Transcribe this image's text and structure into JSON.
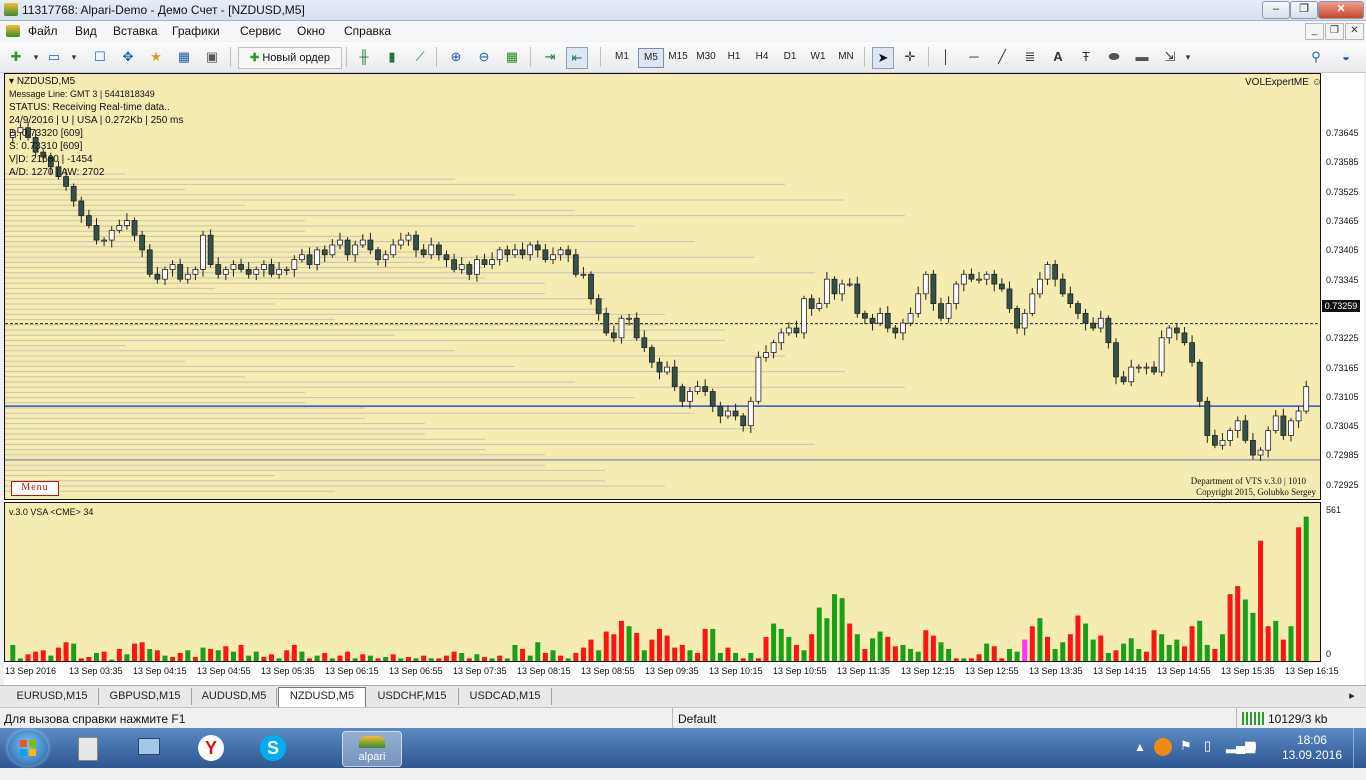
{
  "window": {
    "title": "11317768: Alpari-Demo - Демо Счет - [NZDUSD,M5]",
    "controls": {
      "minimize": "–",
      "restore": "❐",
      "close": "✕"
    }
  },
  "menu": [
    "Файл",
    "Вид",
    "Вставка",
    "Графики",
    "Сервис",
    "Окно",
    "Справка"
  ],
  "toolbar": {
    "new_order": "Новый ордер",
    "timeframes": [
      "M1",
      "M5",
      "M15",
      "M30",
      "H1",
      "H4",
      "D1",
      "W1",
      "MN"
    ],
    "active_timeframe": "M5"
  },
  "chart": {
    "symbol_label": "NZDUSD,M5",
    "overlay_lines": [
      "Message Line: GMT 3 | 5441818349",
      "STATUS:  Receiving Real-time data..",
      "24/9/2016 | U | USA | 0.272Kb | 250 ms",
      "D: 0.73320  [609]",
      "S: 0.73310  [609]",
      "V|D: 21680 | -1454",
      "A/D: 1270 | AW: 2702"
    ],
    "expert_label": "VOLExpertME",
    "menu_badge": "Menu",
    "credit_line_1": "Department of VTS  v.3.0 | 1010",
    "credit_line_2": "Copyright 2015, Golubko Sergey",
    "current_price": "0.73259",
    "blue_level": 0.7309,
    "grey_level": 0.7298,
    "accent_colors": {
      "bull": "#ffffff",
      "bear": "#35524a",
      "vol_up": "#18a018",
      "vol_down": "#ff1414",
      "vol_climax": "#ff30ff",
      "level": "#3050d0"
    }
  },
  "chart_data": [
    {
      "type": "candlestick",
      "title": "NZDUSD,M5",
      "ylim": [
        0.729,
        0.7377
      ],
      "y_ticks": [
        "0.73645",
        "0.73585",
        "0.73525",
        "0.73465",
        "0.73405",
        "0.73345",
        "0.73285",
        "0.73225",
        "0.73165",
        "0.73105",
        "0.73045",
        "0.72985",
        "0.72925"
      ],
      "x_ticks": [
        "13 Sep 2016",
        "13 Sep 03:35",
        "13 Sep 04:15",
        "13 Sep 04:55",
        "13 Sep 05:35",
        "13 Sep 06:15",
        "13 Sep 06:55",
        "13 Sep 07:35",
        "13 Sep 08:15",
        "13 Sep 08:55",
        "13 Sep 09:35",
        "13 Sep 10:15",
        "13 Sep 10:55",
        "13 Sep 11:35",
        "13 Sep 12:15",
        "13 Sep 12:55",
        "13 Sep 13:35",
        "13 Sep 14:15",
        "13 Sep 14:55",
        "13 Sep 15:35",
        "13 Sep 16:15"
      ],
      "close": [
        0.7365,
        0.7366,
        0.7364,
        0.7361,
        0.736,
        0.7358,
        0.7356,
        0.7354,
        0.7351,
        0.7348,
        0.7346,
        0.7343,
        0.7343,
        0.7345,
        0.7346,
        0.7347,
        0.7344,
        0.7341,
        0.7336,
        0.7335,
        0.7337,
        0.7338,
        0.7335,
        0.7336,
        0.7337,
        0.7344,
        0.7338,
        0.7336,
        0.7337,
        0.7338,
        0.7337,
        0.7336,
        0.7337,
        0.7338,
        0.7336,
        0.7337,
        0.7337,
        0.7339,
        0.734,
        0.7338,
        0.7341,
        0.734,
        0.7342,
        0.7343,
        0.734,
        0.7342,
        0.7343,
        0.7341,
        0.7339,
        0.734,
        0.7342,
        0.7343,
        0.7344,
        0.7341,
        0.734,
        0.7342,
        0.734,
        0.7339,
        0.7337,
        0.7338,
        0.7336,
        0.7339,
        0.7338,
        0.7339,
        0.7341,
        0.734,
        0.7341,
        0.734,
        0.7342,
        0.7341,
        0.7339,
        0.734,
        0.7341,
        0.734,
        0.7336,
        0.7336,
        0.7331,
        0.7328,
        0.7324,
        0.7323,
        0.7327,
        0.7327,
        0.7323,
        0.7321,
        0.7318,
        0.7316,
        0.7317,
        0.7313,
        0.731,
        0.7312,
        0.7313,
        0.7312,
        0.7309,
        0.7307,
        0.7308,
        0.7307,
        0.7305,
        0.731,
        0.7319,
        0.732,
        0.7322,
        0.7324,
        0.7325,
        0.7324,
        0.7331,
        0.7329,
        0.733,
        0.7335,
        0.7332,
        0.7334,
        0.7334,
        0.7328,
        0.7327,
        0.7326,
        0.7328,
        0.7325,
        0.7324,
        0.7326,
        0.7328,
        0.7332,
        0.7336,
        0.733,
        0.7327,
        0.733,
        0.7334,
        0.7336,
        0.7335,
        0.7335,
        0.7336,
        0.7334,
        0.7333,
        0.7329,
        0.7325,
        0.7328,
        0.7332,
        0.7335,
        0.7338,
        0.7335,
        0.7332,
        0.733,
        0.7328,
        0.7326,
        0.7325,
        0.7327,
        0.7322,
        0.7315,
        0.7314,
        0.7317,
        0.7317,
        0.7317,
        0.7316,
        0.7323,
        0.7325,
        0.7324,
        0.7322,
        0.7318,
        0.731,
        0.7303,
        0.7301,
        0.7302,
        0.7304,
        0.7306,
        0.7302,
        0.7299,
        0.73,
        0.7304,
        0.7307,
        0.7303,
        0.7306,
        0.7308,
        0.7313
      ],
      "volume_ylim": [
        0,
        561
      ],
      "volume_max_label": "561",
      "volume_min_label": "0",
      "volumes": [
        60,
        10,
        25,
        35,
        40,
        20,
        50,
        70,
        65,
        10,
        15,
        30,
        35,
        5,
        45,
        25,
        65,
        70,
        45,
        40,
        20,
        15,
        30,
        40,
        15,
        50,
        45,
        40,
        55,
        35,
        60,
        20,
        35,
        15,
        25,
        10,
        40,
        60,
        35,
        10,
        20,
        30,
        10,
        20,
        35,
        10,
        25,
        20,
        10,
        15,
        25,
        10,
        15,
        10,
        20,
        10,
        10,
        20,
        35,
        30,
        10,
        25,
        15,
        10,
        20,
        10,
        60,
        45,
        20,
        70,
        30,
        40,
        20,
        10,
        30,
        50,
        80,
        40,
        110,
        100,
        150,
        130,
        105,
        40,
        80,
        120,
        95,
        50,
        60,
        40,
        30,
        120,
        120,
        30,
        50,
        30,
        10,
        30,
        10,
        90,
        140,
        120,
        90,
        60,
        40,
        100,
        200,
        160,
        250,
        235,
        140,
        100,
        45,
        85,
        110,
        90,
        55,
        60,
        45,
        35,
        115,
        95,
        70,
        45,
        10,
        10,
        10,
        25,
        65,
        55,
        10,
        45,
        35,
        80,
        130,
        160,
        90,
        45,
        70,
        100,
        170,
        140,
        80,
        95,
        30,
        40,
        65,
        85,
        45,
        35,
        115,
        100,
        60,
        80,
        55,
        130,
        150,
        60,
        45,
        100,
        250,
        280,
        230,
        180,
        450,
        130,
        150,
        80,
        130,
        500,
        540
      ],
      "volume_colors": [
        "g",
        "g",
        "r",
        "r",
        "r",
        "g",
        "r",
        "r",
        "g",
        "r",
        "r",
        "g",
        "r",
        "g",
        "r",
        "g",
        "r",
        "r",
        "g",
        "r",
        "g",
        "r",
        "r",
        "g",
        "r",
        "g",
        "r",
        "g",
        "r",
        "g",
        "r",
        "g",
        "g",
        "r",
        "r",
        "g",
        "r",
        "r",
        "g",
        "r",
        "g",
        "r",
        "g",
        "r",
        "r",
        "g",
        "r",
        "g",
        "r",
        "g",
        "r",
        "g",
        "r",
        "g",
        "r",
        "g",
        "r",
        "r",
        "r",
        "g",
        "r",
        "g",
        "r",
        "g",
        "r",
        "g",
        "g",
        "r",
        "g",
        "g",
        "r",
        "g",
        "r",
        "g",
        "r",
        "r",
        "r",
        "g",
        "r",
        "r",
        "r",
        "g",
        "r",
        "g",
        "r",
        "r",
        "r",
        "r",
        "r",
        "g",
        "r",
        "r",
        "g",
        "g",
        "r",
        "g",
        "r",
        "g",
        "r",
        "r",
        "g",
        "g",
        "g",
        "r",
        "g",
        "r",
        "g",
        "g",
        "g",
        "g",
        "r",
        "g",
        "r",
        "g",
        "g",
        "r",
        "r",
        "g",
        "g",
        "g",
        "r",
        "r",
        "g",
        "g",
        "r",
        "g",
        "r",
        "r",
        "g",
        "r",
        "r",
        "g",
        "g",
        "m",
        "r",
        "g",
        "r",
        "g",
        "g",
        "r",
        "r",
        "g",
        "g",
        "r",
        "g",
        "r",
        "g",
        "g",
        "g",
        "r",
        "r",
        "g",
        "g",
        "g",
        "r",
        "r",
        "g",
        "g",
        "r",
        "g",
        "r",
        "r",
        "g",
        "g",
        "r",
        "r",
        "g",
        "r",
        "g",
        "r",
        "g"
      ]
    }
  ],
  "symbol_tabs": [
    "EURUSD,M15",
    "GBPUSD,M15",
    "AUDUSD,M5",
    "NZDUSD,M5",
    "USDCHF,M15",
    "USDCAD,M15"
  ],
  "active_tab": "NZDUSD,M5",
  "indicator_label": "v.3.0 VSA <CME> 34",
  "status": {
    "help": "Для вызова справки нажмите F1",
    "profile": "Default",
    "traffic": "10129/3 kb"
  },
  "taskbar": {
    "app_label": "alpari",
    "time": "18:06",
    "date": "13.09.2016"
  }
}
